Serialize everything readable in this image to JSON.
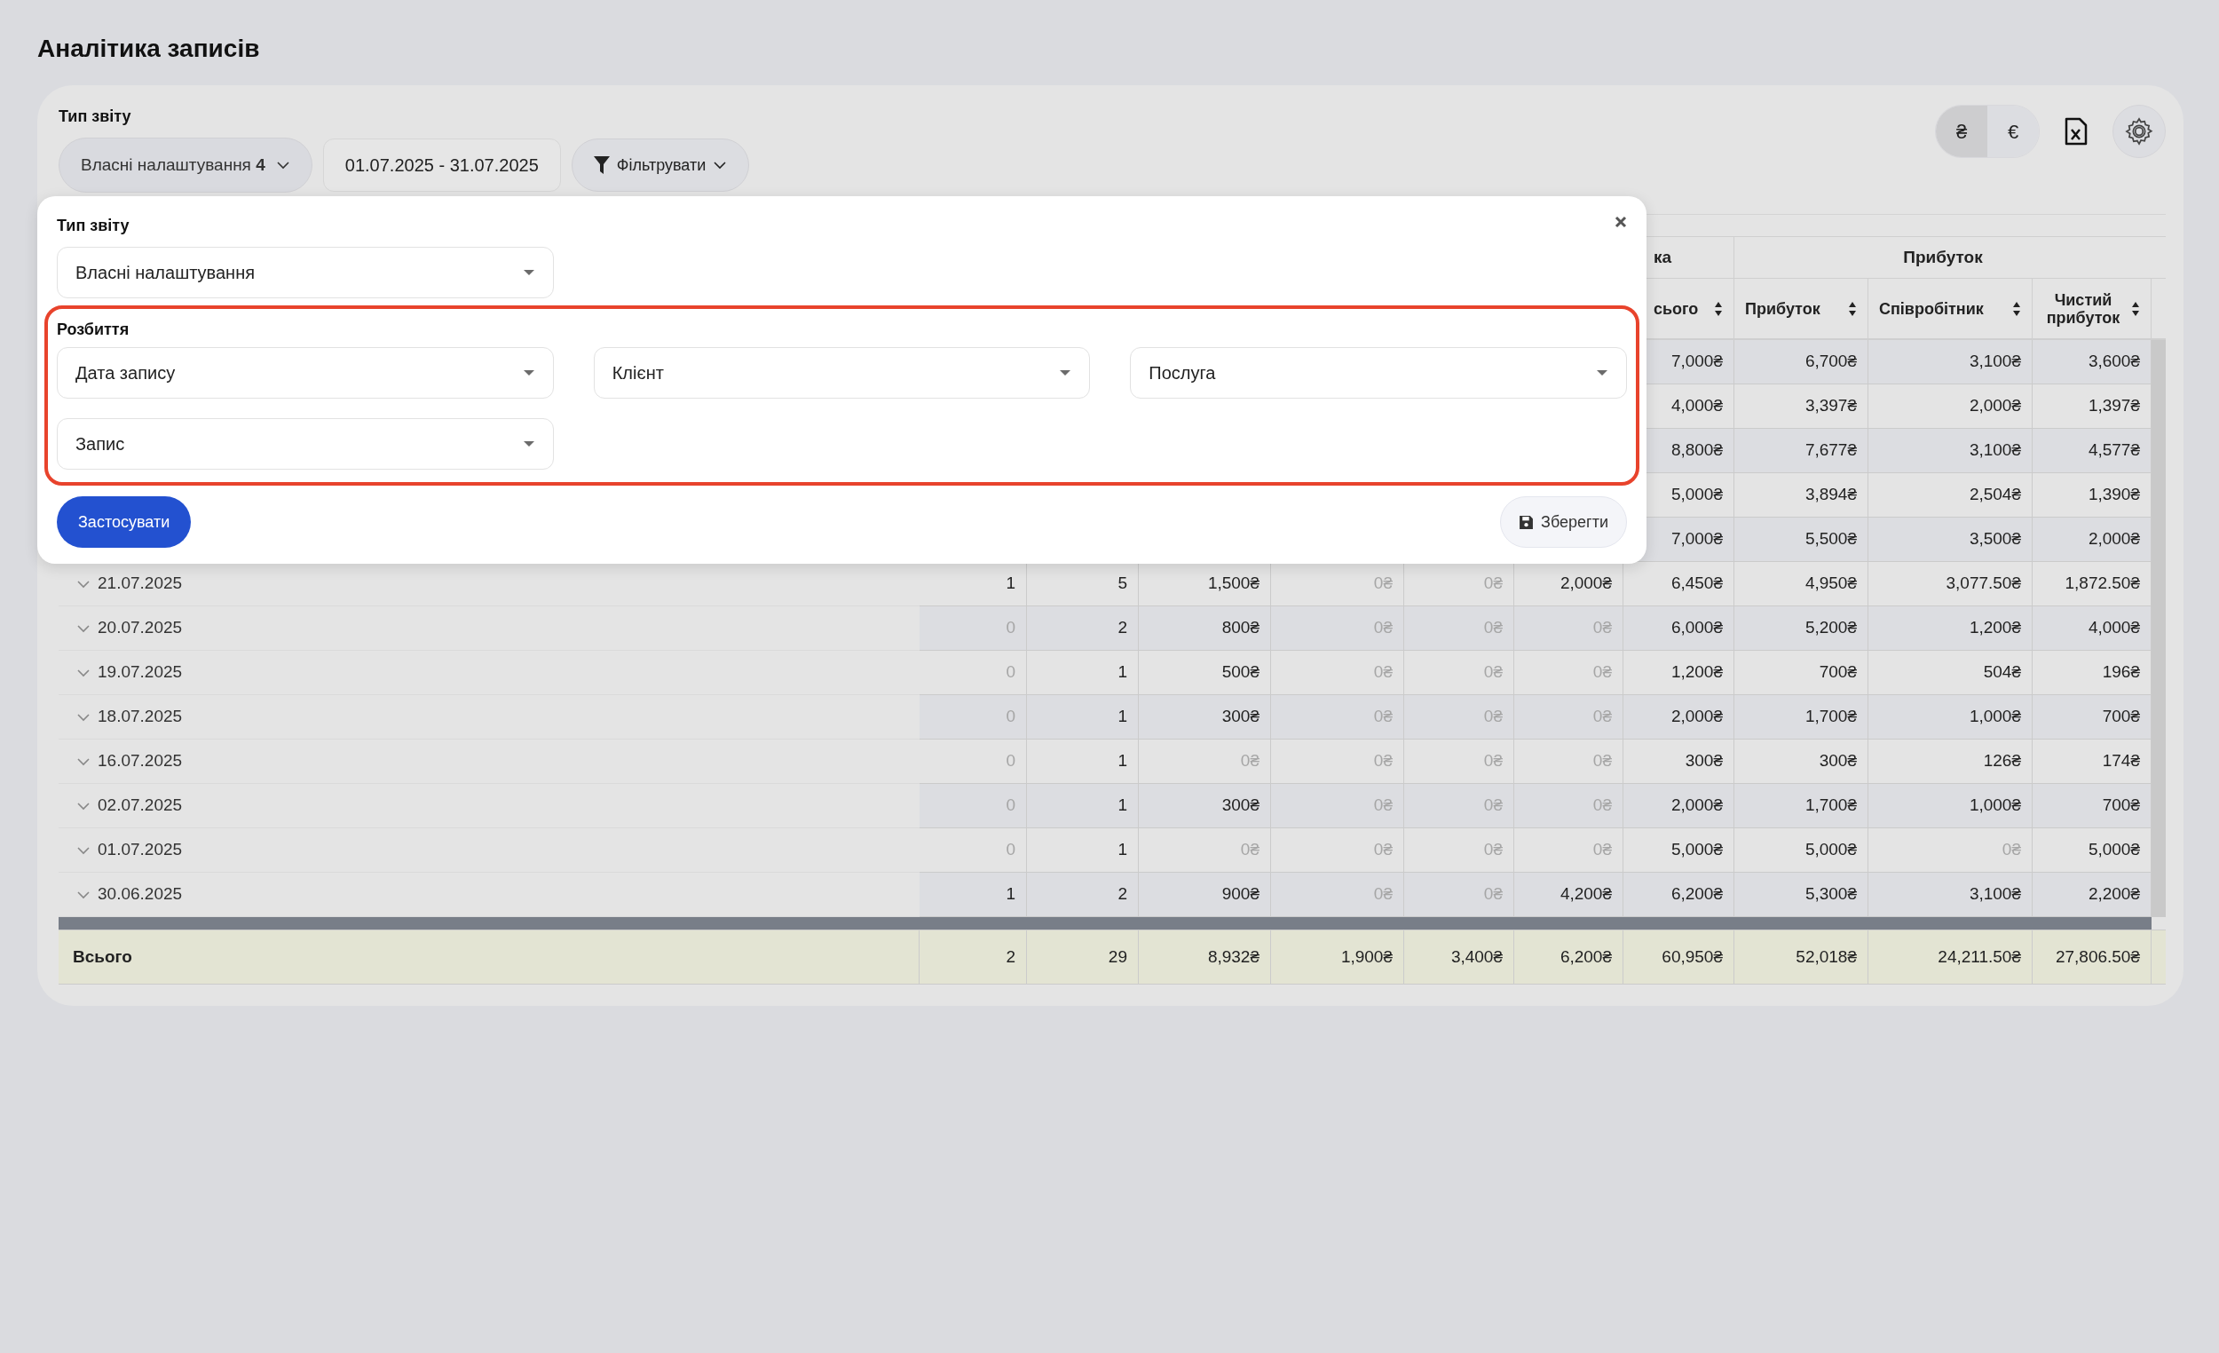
{
  "page_title": "Аналітика записів",
  "toolbar": {
    "report_type_label": "Тип звіту",
    "report_type_button": "Власні налаштування **4**",
    "date_range": "01.07.2025 - 31.07.2025",
    "filter_button": "Фільтрувати",
    "currencies": [
      {
        "symbol": "₴",
        "selected": true
      },
      {
        "symbol": "€",
        "selected": false
      }
    ]
  },
  "table": {
    "group_headers": [
      {
        "label": "ка"
      },
      {
        "label": "Прибуток"
      }
    ],
    "columns": [
      {
        "label": "сього"
      },
      {
        "label": "Прибуток"
      },
      {
        "label": "Співробітник"
      },
      {
        "label": "Чистий прибуток"
      }
    ],
    "rows": [
      {
        "cells": [
          {
            "v": "7,000₴",
            "dim": false
          },
          {
            "v": "6,700₴",
            "dim": false
          },
          {
            "v": "3,100₴",
            "dim": false
          },
          {
            "v": "3,600₴",
            "dim": false
          }
        ]
      },
      {
        "cells": [
          {
            "v": "4,000₴",
            "dim": false
          },
          {
            "v": "3,397₴",
            "dim": false
          },
          {
            "v": "2,000₴",
            "dim": false
          },
          {
            "v": "1,397₴",
            "dim": false
          }
        ]
      },
      {
        "cells": [
          {
            "v": "8,800₴",
            "dim": false
          },
          {
            "v": "7,677₴",
            "dim": false
          },
          {
            "v": "3,100₴",
            "dim": false
          },
          {
            "v": "4,577₴",
            "dim": false
          }
        ]
      },
      {
        "cells": [
          {
            "v": "5,000₴",
            "dim": false
          },
          {
            "v": "3,894₴",
            "dim": false
          },
          {
            "v": "2,504₴",
            "dim": false
          },
          {
            "v": "1,390₴",
            "dim": false
          }
        ]
      },
      {
        "cells": [
          {
            "v": "7,000₴",
            "dim": false
          },
          {
            "v": "5,500₴",
            "dim": false
          },
          {
            "v": "3,500₴",
            "dim": false
          },
          {
            "v": "2,000₴",
            "dim": false
          }
        ]
      },
      {
        "label": "21.07.2025",
        "cells": [
          {
            "v": "1",
            "dim": false
          },
          {
            "v": "5",
            "dim": false
          },
          {
            "v": "1,500₴",
            "dim": false
          },
          {
            "v": "0₴",
            "dim": true
          },
          {
            "v": "0₴",
            "dim": true
          },
          {
            "v": "2,000₴",
            "dim": false
          },
          {
            "v": "6,450₴",
            "dim": false
          },
          {
            "v": "4,950₴",
            "dim": false
          },
          {
            "v": "3,077.50₴",
            "dim": false
          },
          {
            "v": "1,872.50₴",
            "dim": false
          }
        ]
      },
      {
        "label": "20.07.2025",
        "cells": [
          {
            "v": "0",
            "dim": true
          },
          {
            "v": "2",
            "dim": false
          },
          {
            "v": "800₴",
            "dim": false
          },
          {
            "v": "0₴",
            "dim": true
          },
          {
            "v": "0₴",
            "dim": true
          },
          {
            "v": "0₴",
            "dim": true
          },
          {
            "v": "6,000₴",
            "dim": false
          },
          {
            "v": "5,200₴",
            "dim": false
          },
          {
            "v": "1,200₴",
            "dim": false
          },
          {
            "v": "4,000₴",
            "dim": false
          }
        ]
      },
      {
        "label": "19.07.2025",
        "cells": [
          {
            "v": "0",
            "dim": true
          },
          {
            "v": "1",
            "dim": false
          },
          {
            "v": "500₴",
            "dim": false
          },
          {
            "v": "0₴",
            "dim": true
          },
          {
            "v": "0₴",
            "dim": true
          },
          {
            "v": "0₴",
            "dim": true
          },
          {
            "v": "1,200₴",
            "dim": false
          },
          {
            "v": "700₴",
            "dim": false
          },
          {
            "v": "504₴",
            "dim": false
          },
          {
            "v": "196₴",
            "dim": false
          }
        ]
      },
      {
        "label": "18.07.2025",
        "cells": [
          {
            "v": "0",
            "dim": true
          },
          {
            "v": "1",
            "dim": false
          },
          {
            "v": "300₴",
            "dim": false
          },
          {
            "v": "0₴",
            "dim": true
          },
          {
            "v": "0₴",
            "dim": true
          },
          {
            "v": "0₴",
            "dim": true
          },
          {
            "v": "2,000₴",
            "dim": false
          },
          {
            "v": "1,700₴",
            "dim": false
          },
          {
            "v": "1,000₴",
            "dim": false
          },
          {
            "v": "700₴",
            "dim": false
          }
        ]
      },
      {
        "label": "16.07.2025",
        "cells": [
          {
            "v": "0",
            "dim": true
          },
          {
            "v": "1",
            "dim": false
          },
          {
            "v": "0₴",
            "dim": true
          },
          {
            "v": "0₴",
            "dim": true
          },
          {
            "v": "0₴",
            "dim": true
          },
          {
            "v": "0₴",
            "dim": true
          },
          {
            "v": "300₴",
            "dim": false
          },
          {
            "v": "300₴",
            "dim": false
          },
          {
            "v": "126₴",
            "dim": false
          },
          {
            "v": "174₴",
            "dim": false
          }
        ]
      },
      {
        "label": "02.07.2025",
        "cells": [
          {
            "v": "0",
            "dim": true
          },
          {
            "v": "1",
            "dim": false
          },
          {
            "v": "300₴",
            "dim": false
          },
          {
            "v": "0₴",
            "dim": true
          },
          {
            "v": "0₴",
            "dim": true
          },
          {
            "v": "0₴",
            "dim": true
          },
          {
            "v": "2,000₴",
            "dim": false
          },
          {
            "v": "1,700₴",
            "dim": false
          },
          {
            "v": "1,000₴",
            "dim": false
          },
          {
            "v": "700₴",
            "dim": false
          }
        ]
      },
      {
        "label": "01.07.2025",
        "cells": [
          {
            "v": "0",
            "dim": true
          },
          {
            "v": "1",
            "dim": false
          },
          {
            "v": "0₴",
            "dim": true
          },
          {
            "v": "0₴",
            "dim": true
          },
          {
            "v": "0₴",
            "dim": true
          },
          {
            "v": "0₴",
            "dim": true
          },
          {
            "v": "5,000₴",
            "dim": false
          },
          {
            "v": "5,000₴",
            "dim": false
          },
          {
            "v": "0₴",
            "dim": true
          },
          {
            "v": "5,000₴",
            "dim": false
          }
        ]
      },
      {
        "label": "30.06.2025",
        "cells": [
          {
            "v": "1",
            "dim": false
          },
          {
            "v": "2",
            "dim": false
          },
          {
            "v": "900₴",
            "dim": false
          },
          {
            "v": "0₴",
            "dim": true
          },
          {
            "v": "0₴",
            "dim": true
          },
          {
            "v": "4,200₴",
            "dim": false
          },
          {
            "v": "6,200₴",
            "dim": false
          },
          {
            "v": "5,300₴",
            "dim": false
          },
          {
            "v": "3,100₴",
            "dim": false
          },
          {
            "v": "2,200₴",
            "dim": false
          }
        ]
      }
    ],
    "total": {
      "label": "Всього",
      "cells": [
        "2",
        "29",
        "8,932₴",
        "1,900₴",
        "3,400₴",
        "6,200₴",
        "60,950₴",
        "52,018₴",
        "24,211.50₴",
        "27,806.50₴"
      ]
    }
  },
  "popup": {
    "report_type_label": "Тип звіту",
    "report_type_value": "Власні налаштування",
    "breakdown_label": "Розбиття",
    "breakdown": [
      "Дата запису",
      "Клієнт",
      "Послуга",
      "Запис"
    ],
    "apply_button": "Застосувати",
    "save_button": "Зберегти"
  }
}
